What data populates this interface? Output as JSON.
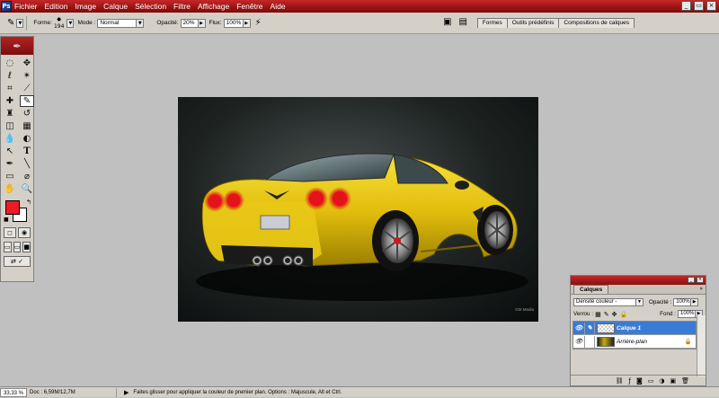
{
  "menu": {
    "items": [
      "Fichier",
      "Edition",
      "Image",
      "Calque",
      "Sélection",
      "Filtre",
      "Affichage",
      "Fenêtre",
      "Aide"
    ],
    "app_icon": "photoshop-icon"
  },
  "window_controls": {
    "minimize": "_",
    "restore": "▭",
    "close": "×"
  },
  "options": {
    "forme_label": "Forme:",
    "brush_size": "194",
    "mode_label": "Mode :",
    "mode_value": "Normal",
    "opacity_label": "Opacité:",
    "opacity_value": "20%",
    "flux_label": "Flux:",
    "flux_value": "100%"
  },
  "palette_tabs": [
    "Formes",
    "Outils prédéfinis",
    "Compositions de calques"
  ],
  "toolbox": {
    "foreground_color": "#ed1c24",
    "background_color": "#ffffff",
    "tools": [
      "marquee-icon",
      "move-icon",
      "lasso-icon",
      "magic-wand-icon",
      "crop-icon",
      "slice-icon",
      "healing-icon",
      "brush-icon",
      "stamp-icon",
      "history-brush-icon",
      "eraser-icon",
      "gradient-icon",
      "blur-icon",
      "dodge-icon",
      "path-select-icon",
      "type-icon",
      "pen-icon",
      "line-icon",
      "notes-icon",
      "eyedropper-icon",
      "hand-icon",
      "zoom-icon"
    ]
  },
  "layers_panel": {
    "tab": "Calques",
    "blend_mode": "Densité couleur -",
    "opacity_label": "Opacité :",
    "opacity_value": "100%",
    "lock_label": "Verrou :",
    "fill_label": "Fond :",
    "fill_value": "100%",
    "layers": [
      {
        "name": "Calque 1",
        "selected": true
      },
      {
        "name": "Arrière-plan",
        "selected": false
      }
    ]
  },
  "canvas": {
    "watermark": "GM Media"
  },
  "status": {
    "zoom": "33,33 %",
    "doc": "Doc : 6,59M/12,7M",
    "hint": "Faites glisser pour appliquer la couleur de premier plan. Options : Majuscule, Alt et Ctrl."
  }
}
